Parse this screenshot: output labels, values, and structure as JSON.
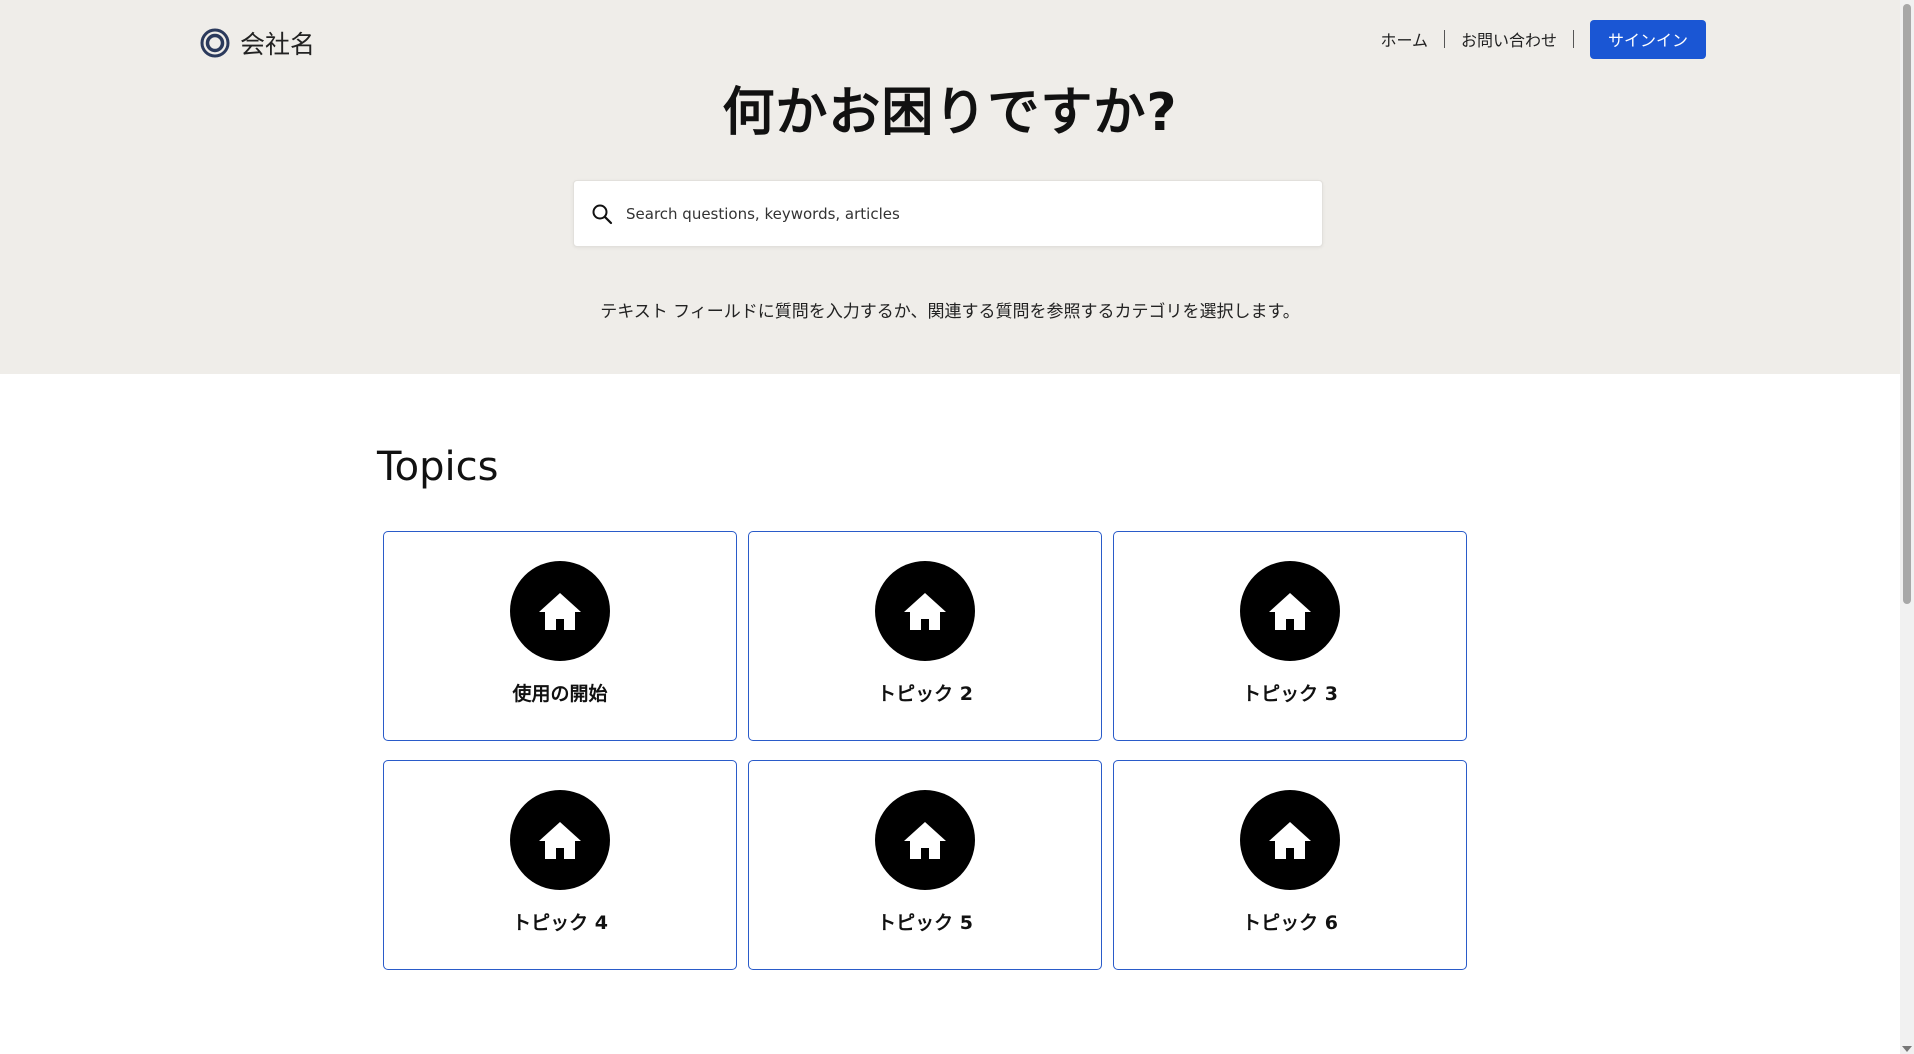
{
  "header": {
    "brand_name": "会社名",
    "nav": {
      "home_label": "ホーム",
      "contact_label": "お問い合わせ",
      "signin_label": "サインイン"
    }
  },
  "hero": {
    "title": "何かお困りですか?",
    "search": {
      "placeholder": "Search questions, keywords, articles",
      "value": ""
    },
    "description": "テキスト フィールドに質問を入力するか、関連する質問を参照するカテゴリを選択します。"
  },
  "topics": {
    "heading": "Topics",
    "items": [
      {
        "label": "使用の開始",
        "icon": "home-icon"
      },
      {
        "label": "トピック 2",
        "icon": "home-icon"
      },
      {
        "label": "トピック 3",
        "icon": "home-icon"
      },
      {
        "label": "トピック 4",
        "icon": "home-icon"
      },
      {
        "label": "トピック 5",
        "icon": "home-icon"
      },
      {
        "label": "トピック 6",
        "icon": "home-icon"
      }
    ]
  },
  "colors": {
    "hero_bg": "#efede9",
    "accent": "#1a56d4",
    "card_border": "#2a5bc9"
  }
}
